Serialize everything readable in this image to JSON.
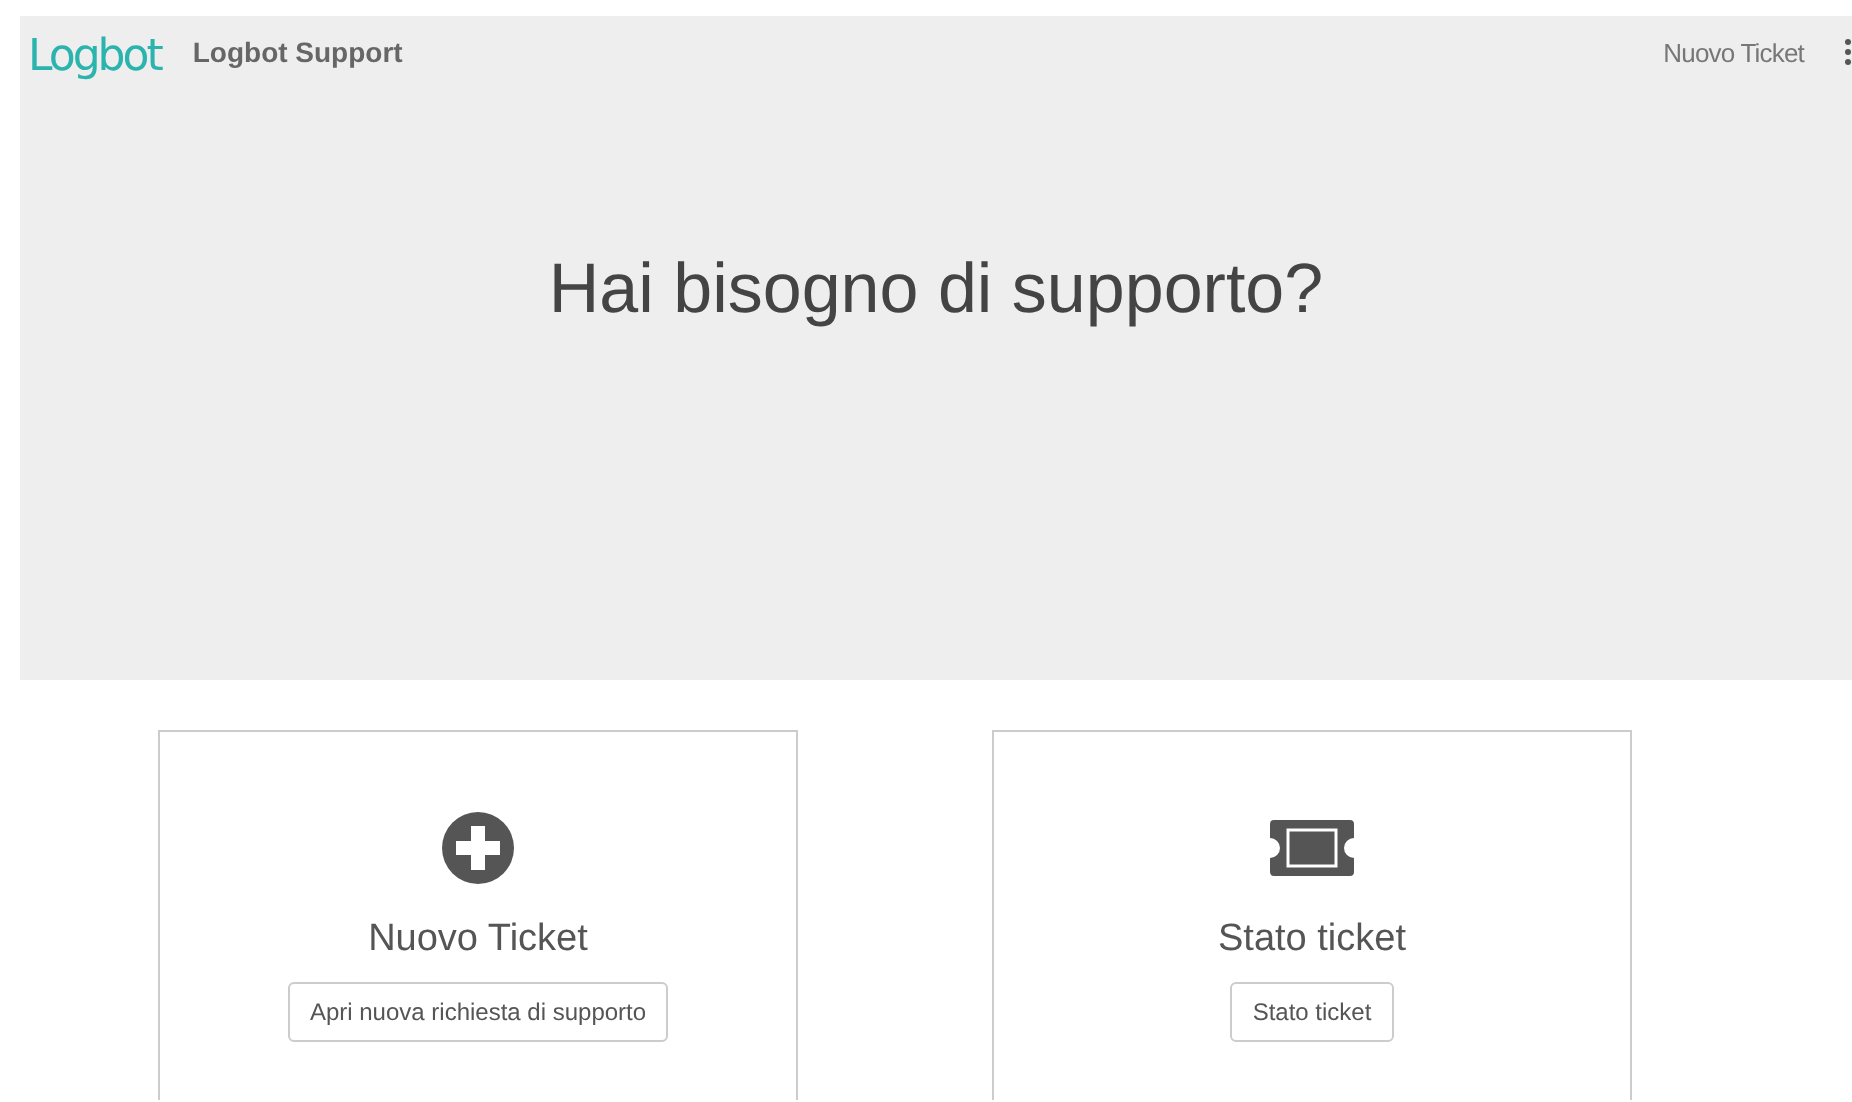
{
  "navbar": {
    "logo": "Logbot",
    "brand": "Logbot Support",
    "links": [
      "Nuovo Ticket"
    ]
  },
  "hero": {
    "title": "Hai bisogno di supporto?"
  },
  "cards": [
    {
      "kind": "plus",
      "title": "Nuovo Ticket",
      "button": "Apri nuova richiesta di supporto"
    },
    {
      "kind": "ticket",
      "title": "Stato ticket",
      "button": "Stato ticket"
    }
  ]
}
